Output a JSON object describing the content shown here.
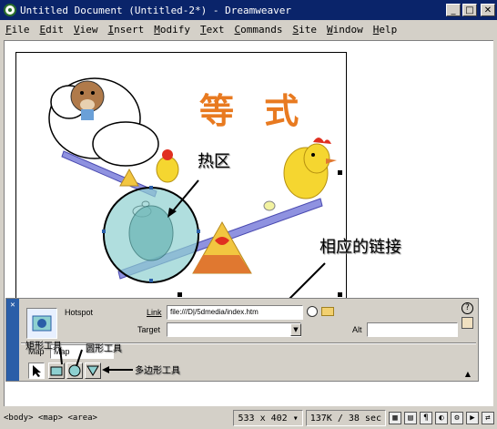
{
  "window": {
    "title": "Untitled Document (Untitled-2*) - Dreamweaver",
    "controls": [
      "minimize",
      "maximize",
      "close"
    ]
  },
  "menu": [
    "File",
    "Edit",
    "View",
    "Insert",
    "Modify",
    "Text",
    "Commands",
    "Site",
    "Window",
    "Help"
  ],
  "menu_underline": [
    "F",
    "E",
    "V",
    "I",
    "M",
    "T",
    "C",
    "S",
    "W",
    "H"
  ],
  "image": {
    "title_chars": "等 式"
  },
  "annotations": {
    "hotspot": "热区",
    "link": "相应的链接",
    "rect_tool": "矩形工具",
    "circle_tool": "圆形工具",
    "poly_tool": "多边形工具"
  },
  "properties": {
    "type": "Hotspot",
    "link_label": "Link",
    "link_value": "file:///D|/5dmedia/index.htm",
    "target_label": "Target",
    "target_value": "",
    "alt_label": "Alt",
    "alt_value": "",
    "map_label": "Map",
    "map_value": "Map"
  },
  "status": {
    "tags": "<body> <map> <area>",
    "dims": "533 x 402",
    "size": "137K / 38 sec"
  }
}
